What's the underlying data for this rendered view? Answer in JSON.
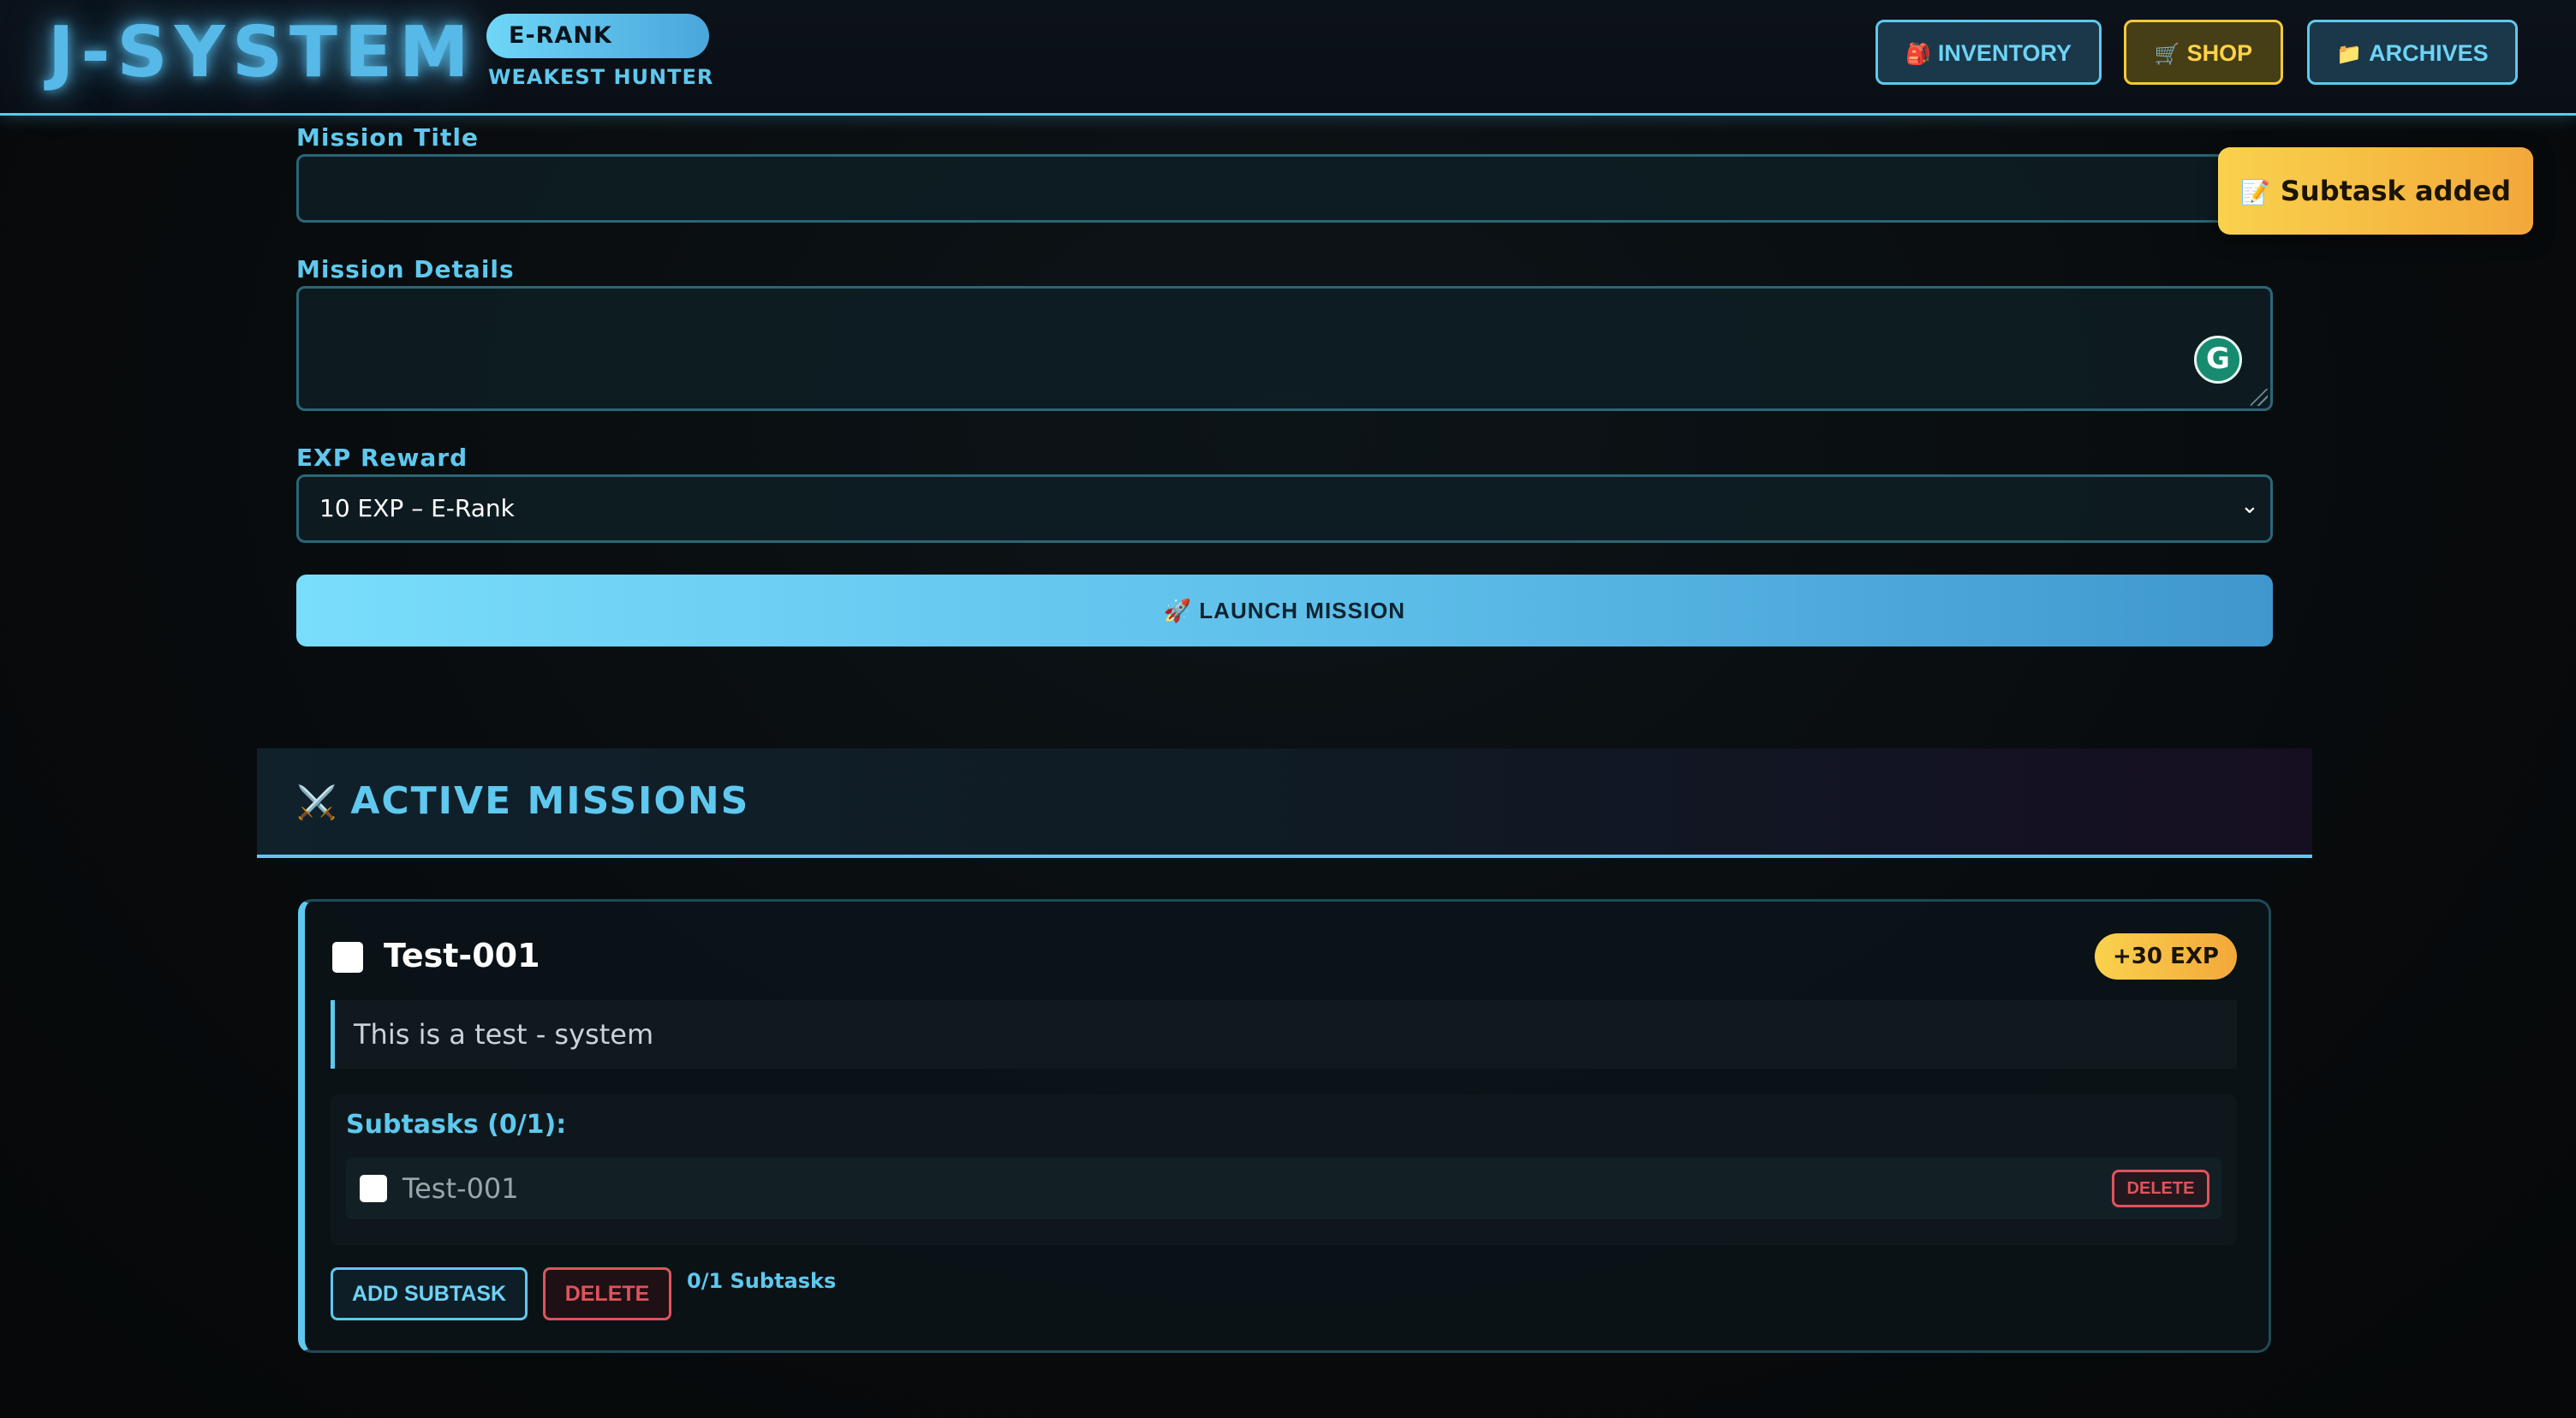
{
  "header": {
    "logo": "J-SYSTEM",
    "rank": "E-RANK",
    "rank_title": "WEAKEST HUNTER",
    "nav": {
      "inventory": {
        "icon": "backpack-icon",
        "emoji": "🎒",
        "label": "INVENTORY"
      },
      "shop": {
        "icon": "cart-icon",
        "emoji": "🛒",
        "label": "SHOP"
      },
      "archives": {
        "icon": "folder-icon",
        "emoji": "📁",
        "label": "ARCHIVES"
      }
    }
  },
  "toast": {
    "icon": "memo-icon",
    "emoji": "📝",
    "message": "Subtask added"
  },
  "form": {
    "title_label": "Mission Title",
    "title_value": "",
    "details_label": "Mission Details",
    "details_value": "",
    "reward_label": "EXP Reward",
    "reward_selected": "10 EXP – E-Rank",
    "launch_icon": "rocket-icon",
    "launch_emoji": "🚀",
    "launch_label": "LAUNCH MISSION",
    "grammarly_glyph": "G"
  },
  "active_missions": {
    "icon": "crossed-swords-icon",
    "emoji": "⚔️",
    "title": "ACTIVE MISSIONS",
    "missions": [
      {
        "title": "Test-001",
        "exp": "+30 EXP",
        "description": "This is a test - system",
        "completed": false,
        "subtasks_heading": "Subtasks (0/1):",
        "subtasks": [
          {
            "label": "Test-001",
            "completed": false,
            "delete_label": "DELETE"
          }
        ],
        "add_subtask_label": "ADD SUBTASK",
        "delete_label": "DELETE",
        "subtask_count": "0/1 Subtasks"
      }
    ]
  },
  "colors": {
    "accent": "#5fc8ee",
    "gold": "#f9d24d",
    "danger": "#e0535b",
    "background": "#080b0d"
  }
}
